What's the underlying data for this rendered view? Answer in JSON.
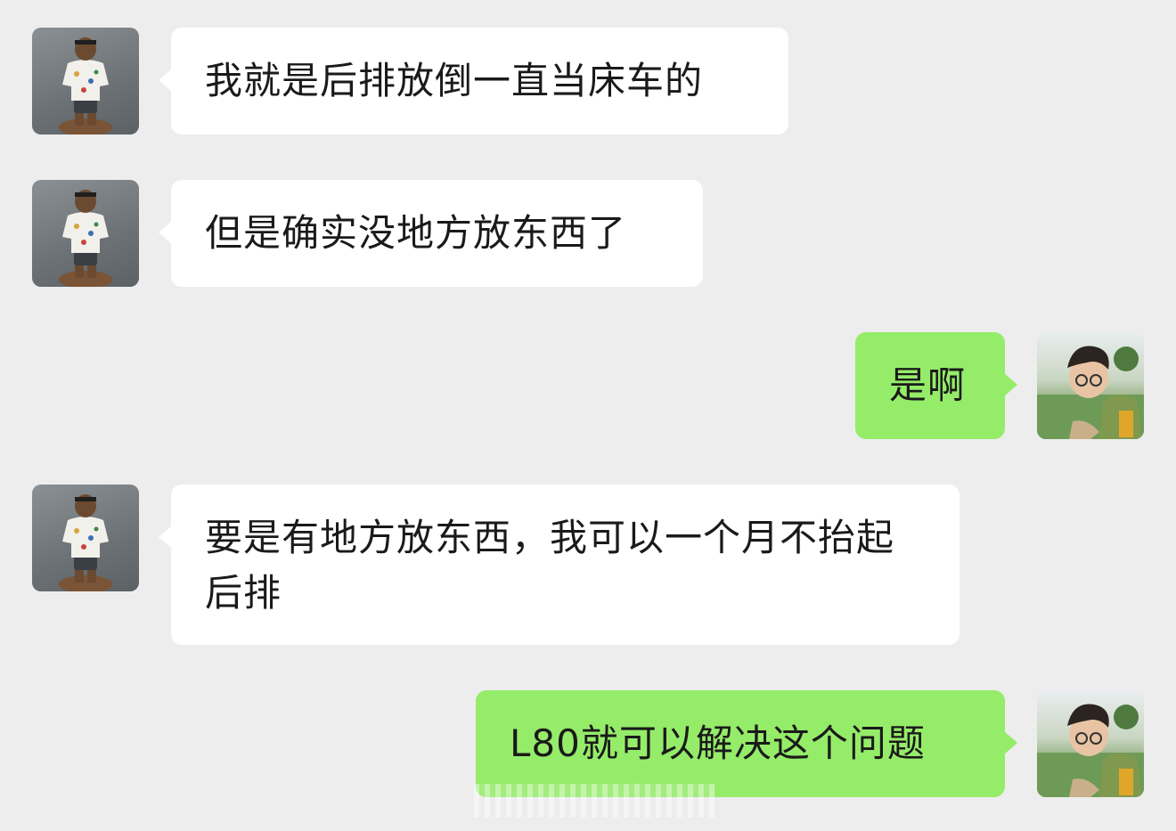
{
  "conversation": {
    "messages": [
      {
        "sender": "contact",
        "text": "我就是后排放倒一直当床车的"
      },
      {
        "sender": "contact",
        "text": "但是确实没地方放东西了"
      },
      {
        "sender": "me",
        "text": "是啊"
      },
      {
        "sender": "contact",
        "text": "要是有地方放东西，我可以一个月不抬起后排"
      },
      {
        "sender": "me",
        "text": "L80就可以解决这个问题"
      }
    ]
  },
  "colors": {
    "background": "#ededed",
    "incoming_bubble": "#ffffff",
    "outgoing_bubble": "#95ec69",
    "text": "#1a1a1a"
  },
  "icons": {
    "contact_avatar": "figurine-avatar",
    "my_avatar": "person-photo-avatar"
  }
}
